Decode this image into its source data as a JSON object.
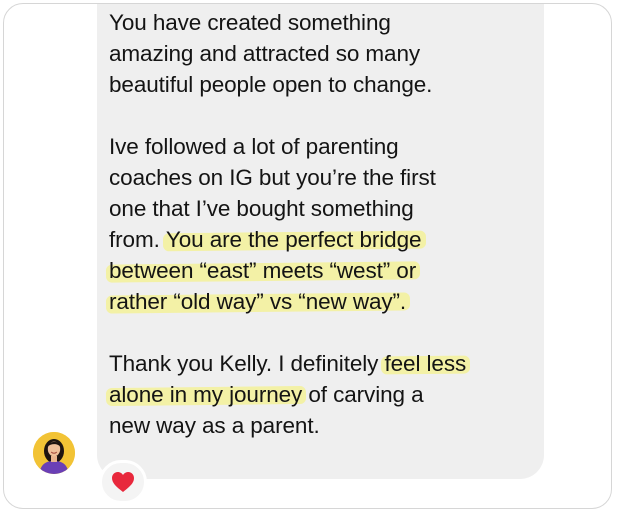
{
  "message": {
    "paragraphs": [
      {
        "lines": [
          [
            {
              "text": "You have created something",
              "hl": false
            }
          ],
          [
            {
              "text": "amazing and attracted so many",
              "hl": false
            }
          ],
          [
            {
              "text": "beautiful people open to change.",
              "hl": false
            }
          ]
        ]
      },
      {
        "lines": [
          [
            {
              "text": "Ive followed a lot of parenting",
              "hl": false
            }
          ],
          [
            {
              "text": "coaches on IG but you’re the first",
              "hl": false
            }
          ],
          [
            {
              "text": "one that I’ve bought something",
              "hl": false
            }
          ],
          [
            {
              "text": "from. ",
              "hl": false
            },
            {
              "text": "You are the perfect bridge",
              "hl": true
            }
          ],
          [
            {
              "text": "between “east” meets “west” or",
              "hl": true
            }
          ],
          [
            {
              "text": "rather “old way” vs “new way”.",
              "hl": true
            }
          ]
        ]
      },
      {
        "lines": [
          [
            {
              "text": "Thank you Kelly. I definitely ",
              "hl": false
            },
            {
              "text": "feel less",
              "hl": true
            }
          ],
          [
            {
              "text": "alone in my journey",
              "hl": true
            },
            {
              "text": " of carving a",
              "hl": false
            }
          ],
          [
            {
              "text": "new way as a parent.",
              "hl": false
            }
          ]
        ]
      }
    ]
  },
  "reaction": {
    "icon": "red-heart-icon",
    "color": "#e8283c"
  },
  "colors": {
    "bubble": "#efefef",
    "highlight": "#f3f1a6",
    "text": "#141414",
    "avatar_bg": "#f2c335"
  }
}
